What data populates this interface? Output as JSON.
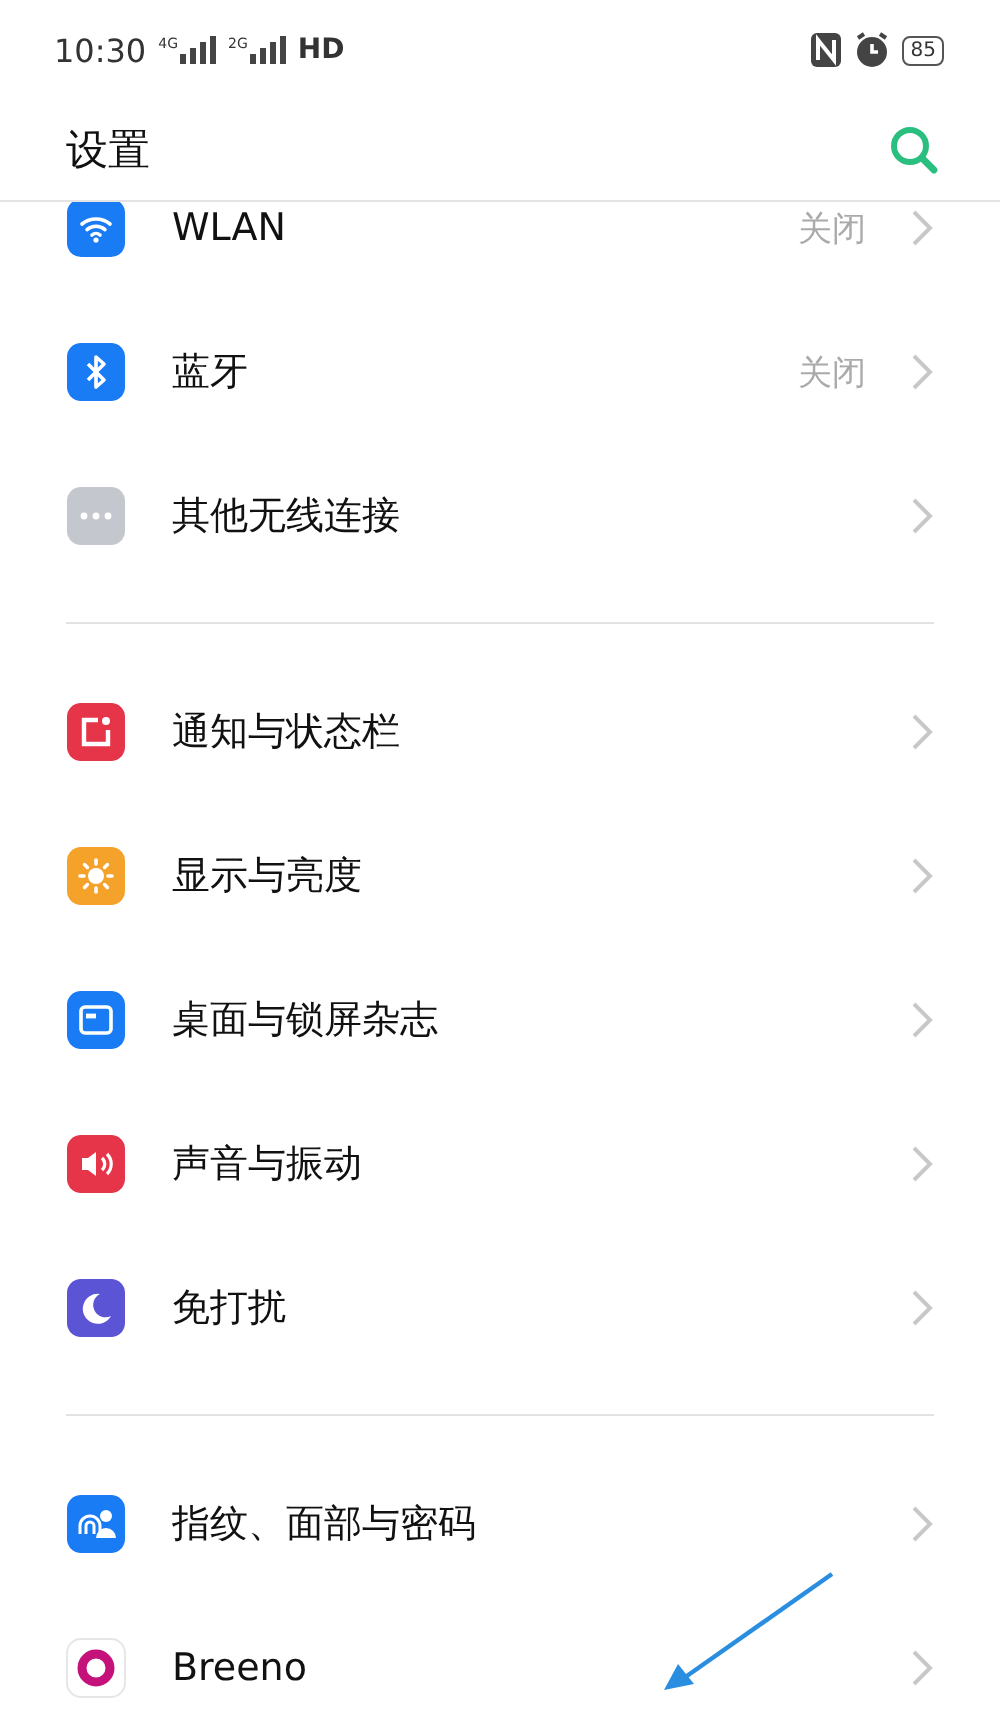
{
  "status_bar": {
    "time": "10:30",
    "network_1": "4G",
    "network_2": "2G",
    "hd": "HD",
    "battery": "85"
  },
  "header": {
    "title": "设置"
  },
  "sections": [
    {
      "items": [
        {
          "label": "WLAN",
          "value": "关闭",
          "kind": "wifi",
          "color": "#1a7cf5"
        },
        {
          "label": "蓝牙",
          "value": "关闭",
          "kind": "bluetooth",
          "color": "#1a7cf5"
        },
        {
          "label": "其他无线连接",
          "kind": "more",
          "color": "#c5c7ce"
        }
      ]
    },
    {
      "items": [
        {
          "label": "通知与状态栏",
          "kind": "notification",
          "color": "#e63548"
        },
        {
          "label": "显示与亮度",
          "kind": "brightness",
          "color": "#f5a22a"
        },
        {
          "label": "桌面与锁屏杂志",
          "kind": "wallpaper",
          "color": "#1a7cf5"
        },
        {
          "label": "声音与振动",
          "kind": "sound",
          "color": "#e63548"
        },
        {
          "label": "免打扰",
          "kind": "moon",
          "color": "#5b55d6"
        }
      ]
    },
    {
      "items": [
        {
          "label": "指纹、面部与密码",
          "kind": "fingerprint",
          "color": "#1a7cf5"
        },
        {
          "label": "Breeno",
          "kind": "breeno",
          "color": "#c4127a"
        }
      ]
    }
  ]
}
